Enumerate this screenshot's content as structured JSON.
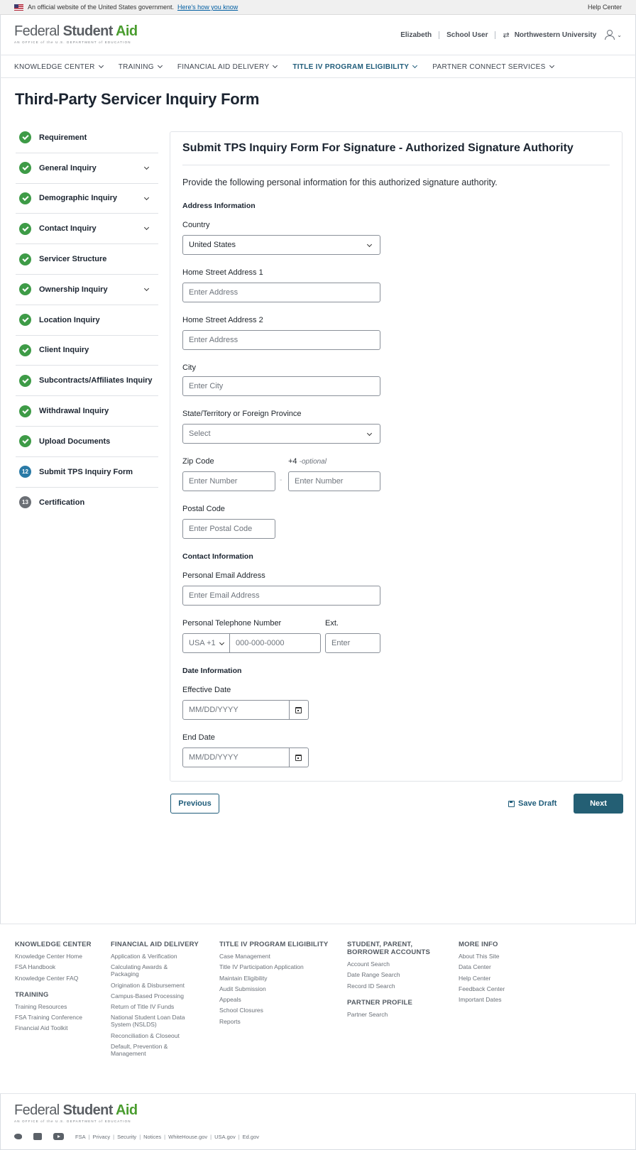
{
  "gov_banner": {
    "text": "An official website of the United States government.",
    "link": "Here's how you know",
    "help": "Help Center"
  },
  "brand": {
    "name_light": "Federal ",
    "name_bold": "Student ",
    "name_green": "Aid",
    "tagline": "AN OFFICE of the U.S. DEPARTMENT of EDUCATION",
    "green": "#4a9d2f",
    "accent": "#245f74"
  },
  "user": {
    "name": "Elizabeth",
    "role": "School User",
    "school": "Northwestern University"
  },
  "nav": [
    {
      "label": "KNOWLEDGE CENTER"
    },
    {
      "label": "TRAINING"
    },
    {
      "label": "FINANCIAL AID DELIVERY"
    },
    {
      "label": "TITLE IV PROGRAM ELIGIBILITY"
    },
    {
      "label": "PARTNER CONNECT SERVICES"
    }
  ],
  "page_title": "Third-Party Servicer Inquiry Form",
  "steps": [
    {
      "label": "Requirement",
      "state": "done"
    },
    {
      "label": "General Inquiry",
      "state": "done"
    },
    {
      "label": "Demographic Inquiry",
      "state": "done"
    },
    {
      "label": "Contact Inquiry",
      "state": "done"
    },
    {
      "label": "Servicer Structure",
      "state": "done"
    },
    {
      "label": "Ownership Inquiry",
      "state": "done"
    },
    {
      "label": "Location Inquiry",
      "state": "done"
    },
    {
      "label": "Client Inquiry",
      "state": "done"
    },
    {
      "label": "Subcontracts/Affiliates Inquiry",
      "state": "done"
    },
    {
      "label": "Withdrawal Inquiry",
      "state": "done"
    },
    {
      "label": "Upload Documents",
      "state": "done"
    },
    {
      "label": "Submit TPS Inquiry Form",
      "state": "current",
      "number": "12"
    },
    {
      "label": "Certification",
      "state": "todo",
      "number": "13"
    }
  ],
  "form": {
    "heading": "Submit TPS Inquiry Form For Signature - Authorized Signature Authority",
    "intro": "Provide the following personal information for this authorized signature authority.",
    "address_section": "Address Information",
    "country_label": "Country",
    "country_value": "United States",
    "street1_label": "Home Street Address 1",
    "street1_placeholder": "Enter Address",
    "street2_label": "Home Street Address 2",
    "street2_placeholder": "Enter Address",
    "city_label": "City",
    "city_placeholder": "Enter City",
    "state_label": "State/Territory or Foreign Province",
    "state_placeholder": "Select",
    "zip_label": "Zip Code",
    "zip4_label": "+4",
    "zip4_optional": "-optional",
    "zip_placeholder": "Enter Number",
    "zip4_placeholder": "Enter Number",
    "zip_dash": "-",
    "postal_label": "Postal Code",
    "postal_placeholder": "Enter Postal Code",
    "contact_section": "Contact Information",
    "email_label": "Personal Email Address",
    "email_placeholder": "Enter Email Address",
    "phone_label": "Personal Telephone Number",
    "phone_country": "USA +1",
    "phone_placeholder": "000-000-0000",
    "ext_label": "Ext.",
    "ext_placeholder": "Enter",
    "date_section": "Date Information",
    "effective_label": "Effective Date",
    "effective_placeholder": "MM/DD/YYYY",
    "end_label": "End Date",
    "end_placeholder": "MM/DD/YYYY"
  },
  "actions": {
    "previous": "Previous",
    "save_draft": "Save Draft",
    "next": "Next"
  },
  "footer": {
    "knowledge_center": {
      "heading": "KNOWLEDGE CENTER",
      "links": [
        "Knowledge Center Home",
        "FSA Handbook",
        "Knowledge Center FAQ"
      ]
    },
    "training": {
      "heading": "TRAINING",
      "links": [
        "Training Resources",
        "FSA Training Conference",
        "Financial Aid Toolkit"
      ]
    },
    "financial_aid_delivery": {
      "heading": "FINANCIAL AID DELIVERY",
      "links": [
        "Application & Verification",
        "Calculating Awards & Packaging",
        "Origination & Disbursement",
        "Campus-Based Processing",
        "Return of Title IV Funds",
        "National Student Loan Data System (NSLDS)",
        "Reconciliation & Closeout",
        "Default, Prevention & Management"
      ]
    },
    "title_iv": {
      "heading": "TITLE IV PROGRAM ELIGIBILITY",
      "links": [
        "Case Management",
        "Title IV Participation Application",
        "Maintain Eligibility",
        "Audit Submission",
        "Appeals",
        "School Closures",
        "Reports"
      ]
    },
    "accounts": {
      "heading": "STUDENT, PARENT, BORROWER ACCOUNTS",
      "links": [
        "Account Search",
        "Date Range Search",
        "Record ID Search"
      ]
    },
    "partner_profile": {
      "heading": "PARTNER PROFILE",
      "links": [
        "Partner Search"
      ]
    },
    "more_info": {
      "heading": "MORE INFO",
      "links": [
        "About This Site",
        "Data Center",
        "Help Center",
        "Feedback Center",
        "Important Dates"
      ]
    },
    "bottom_links": [
      "FSA",
      "Privacy",
      "Security",
      "Notices",
      "WhiteHouse.gov",
      "USA.gov",
      "Ed.gov"
    ]
  }
}
